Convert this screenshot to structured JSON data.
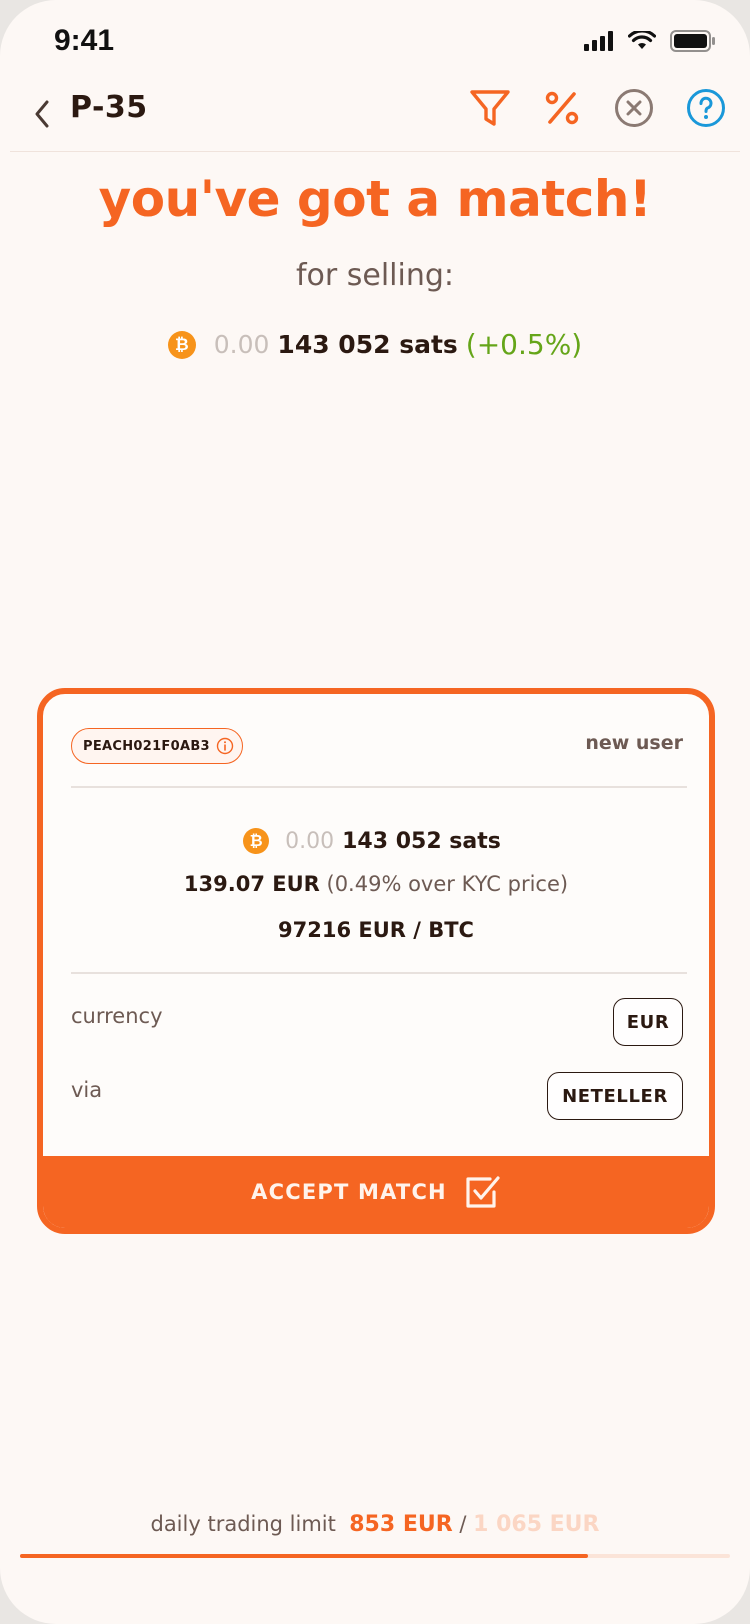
{
  "status_bar": {
    "time": "9:41"
  },
  "header": {
    "title": "P-35"
  },
  "headline": "you've got a match!",
  "subhead": "for selling:",
  "amount": {
    "zeros": "0.00",
    "sats": "143 052 sats",
    "premium": "(+0.5%)"
  },
  "card": {
    "user_id": "PEACH021F0AB3",
    "user_status": "new user",
    "amount_zeros": "0.00",
    "amount_sats": "143 052 sats",
    "fiat_amount": "139.07 EUR",
    "kyc_note": "(0.49% over KYC price)",
    "rate": "97216 EUR / BTC",
    "currency_label": "currency",
    "currency_value": "EUR",
    "via_label": "via",
    "via_value": "NETELLER",
    "accept_label": "ACCEPT MATCH"
  },
  "footer": {
    "limit_label": "daily trading limit",
    "limit_used": "853 EUR",
    "limit_sep": "/",
    "limit_total": "1 065 EUR",
    "limit_progress": 0.8
  },
  "icons": {
    "back": "chevron-left-icon",
    "filter": "filter-icon",
    "percent": "percent-icon",
    "cancel": "circle-x-icon",
    "help": "help-circle-icon",
    "bitcoin": "bitcoin-icon",
    "info": "info-icon",
    "checkbox": "checkbox-icon"
  },
  "colors": {
    "accent": "#f56522",
    "premium": "#65a519",
    "help": "#1a98d9",
    "background": "#fdf8f5",
    "text": "#2b1911"
  }
}
